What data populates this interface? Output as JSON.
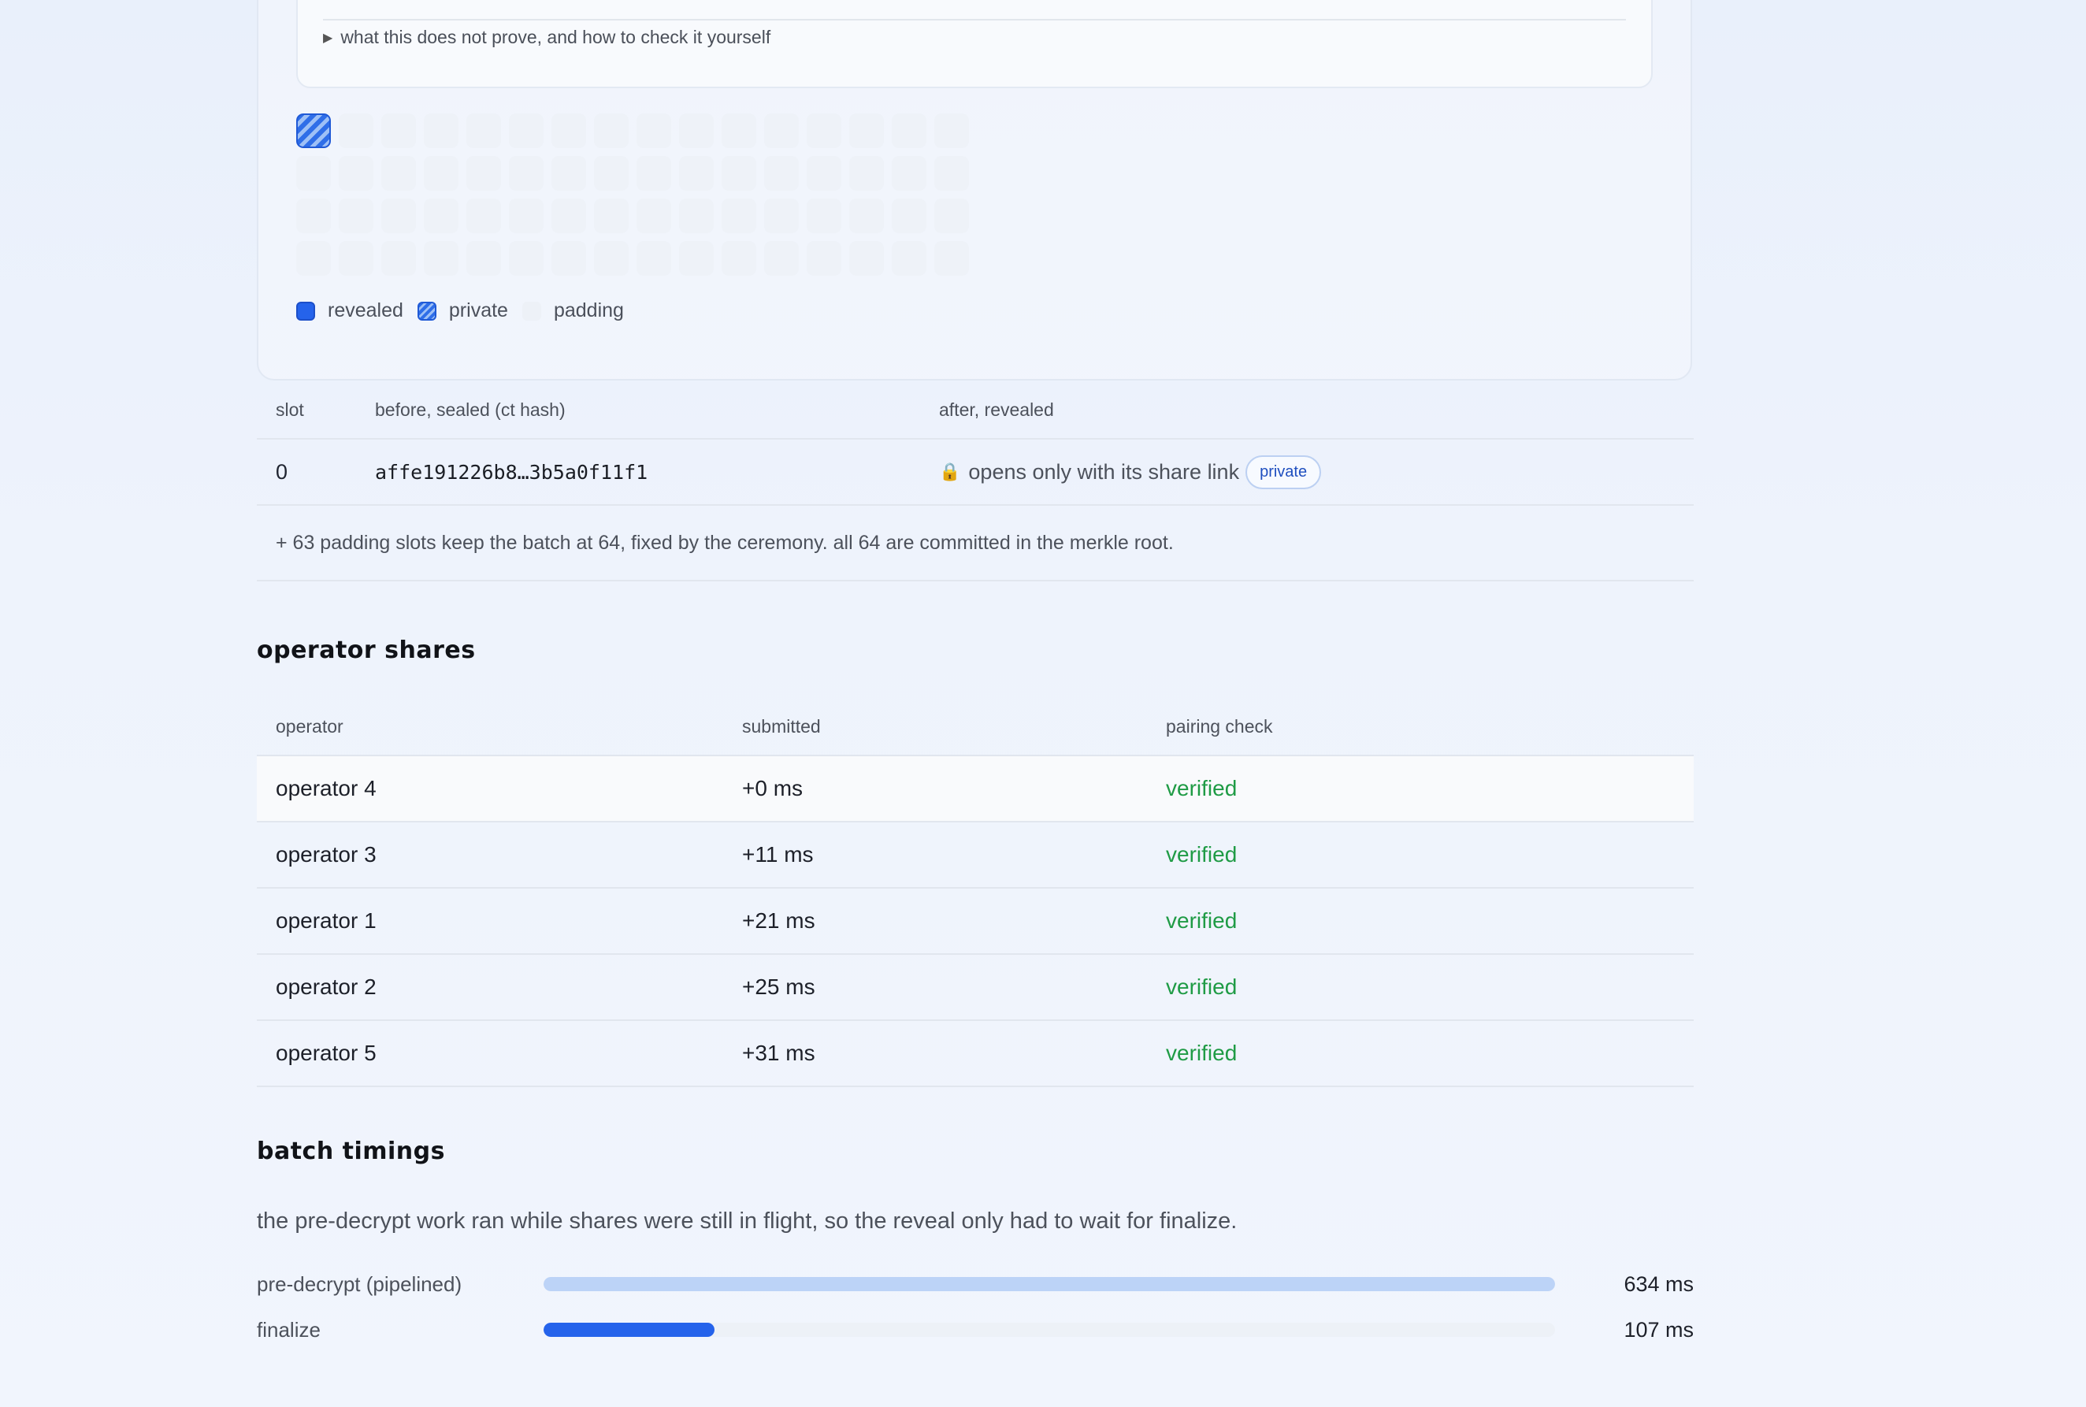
{
  "details": {
    "summary": "what this does not prove, and how to check it yourself"
  },
  "slot_grid": {
    "total": 64,
    "private_slots": [
      0
    ]
  },
  "legend": {
    "revealed": "revealed",
    "private": "private",
    "padding": "padding"
  },
  "slot_table": {
    "headers": {
      "slot": "slot",
      "before": "before, sealed (ct hash)",
      "after": "after, revealed"
    },
    "rows": [
      {
        "slot": "0",
        "hash": "affe191226b8…3b5a0f11f1",
        "after": "opens only with its share link",
        "badge": "private"
      }
    ],
    "note": "+ 63 padding slots keep the batch at 64, fixed by the ceremony. all 64 are committed in the merkle root."
  },
  "operator_shares": {
    "title": "operator shares",
    "headers": {
      "operator": "operator",
      "submitted": "submitted",
      "check": "pairing check"
    },
    "rows": [
      {
        "operator": "operator 4",
        "submitted": "+0 ms",
        "check": "verified"
      },
      {
        "operator": "operator 3",
        "submitted": "+11 ms",
        "check": "verified"
      },
      {
        "operator": "operator 1",
        "submitted": "+21 ms",
        "check": "verified"
      },
      {
        "operator": "operator 2",
        "submitted": "+25 ms",
        "check": "verified"
      },
      {
        "operator": "operator 5",
        "submitted": "+31 ms",
        "check": "verified"
      }
    ]
  },
  "batch_timings": {
    "title": "batch timings",
    "description": "the pre-decrypt work ran while shares were still in flight, so the reveal only had to wait for finalize.",
    "rows": [
      {
        "label": "pre-decrypt (pipelined)",
        "value": "634 ms",
        "fraction": 1.0,
        "color": "#bcd3f7"
      },
      {
        "label": "finalize",
        "value": "107 ms",
        "fraction": 0.169,
        "color": "#2563eb"
      }
    ]
  },
  "colors": {
    "accent": "#2563eb",
    "verified": "#1f9b45"
  }
}
